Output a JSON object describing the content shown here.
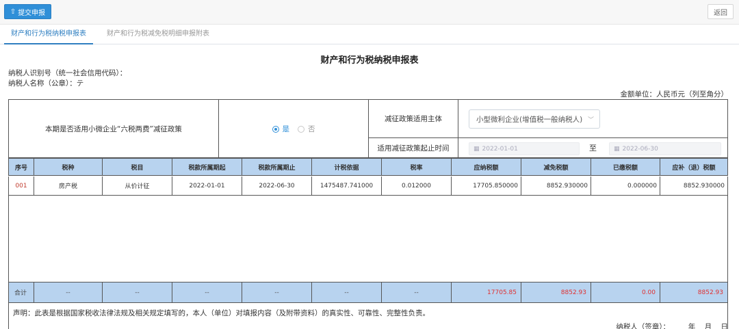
{
  "toolbar": {
    "submit_label": "提交申报",
    "back_label": "返回"
  },
  "tabs": [
    {
      "label": "财产和行为税纳税申报表",
      "active": true
    },
    {
      "label": "财产和行为税减免税明细申报附表",
      "active": false
    }
  ],
  "form": {
    "title": "财产和行为税纳税申报表",
    "taxpayer_id_label": "纳税人识别号（统一社会信用代码）：",
    "taxpayer_name_label": "纳税人名称（公章）：",
    "taxpayer_name_value": "テ",
    "unit_label": "金额单位：人民币元（列至角分）"
  },
  "policy": {
    "question": "本期是否适用小微企业“六税两费”减征政策",
    "yes": "是",
    "no": "否",
    "selected": "是",
    "subject_label": "减征政策适用主体",
    "subject_value": "小型微利企业(增值税一般纳税人)",
    "period_label": "适用减征政策起止时间",
    "start_date": "2022-01-01",
    "to_label": "至",
    "end_date": "2022-06-30"
  },
  "table": {
    "headers": [
      "序号",
      "税种",
      "税目",
      "税款所属期起",
      "税款所属期止",
      "计税依据",
      "税率",
      "应纳税额",
      "减免税额",
      "已缴税额",
      "应补（退）税额"
    ],
    "row": [
      "001",
      "房产税",
      "从价计征",
      "2022-01-01",
      "2022-06-30",
      "1475487.741000",
      "0.012000",
      "17705.850000",
      "8852.930000",
      "0.000000",
      "8852.930000"
    ],
    "total": [
      "合计",
      "--",
      "--",
      "--",
      "--",
      "--",
      "--",
      "17705.85",
      "8852.93",
      "0.00",
      "8852.93"
    ]
  },
  "footer": {
    "declaration": "声明：此表是根据国家税收法律法规及相关规定填写的，本人（单位）对填报内容（及附带资料）的真实性、可靠性、完整性负责。",
    "sign": "纳税人（签章）：        年    月    日"
  },
  "colors": {
    "accent": "#2f8fd8",
    "header_bg": "#b8d3ef",
    "total_red": "#e03030"
  }
}
